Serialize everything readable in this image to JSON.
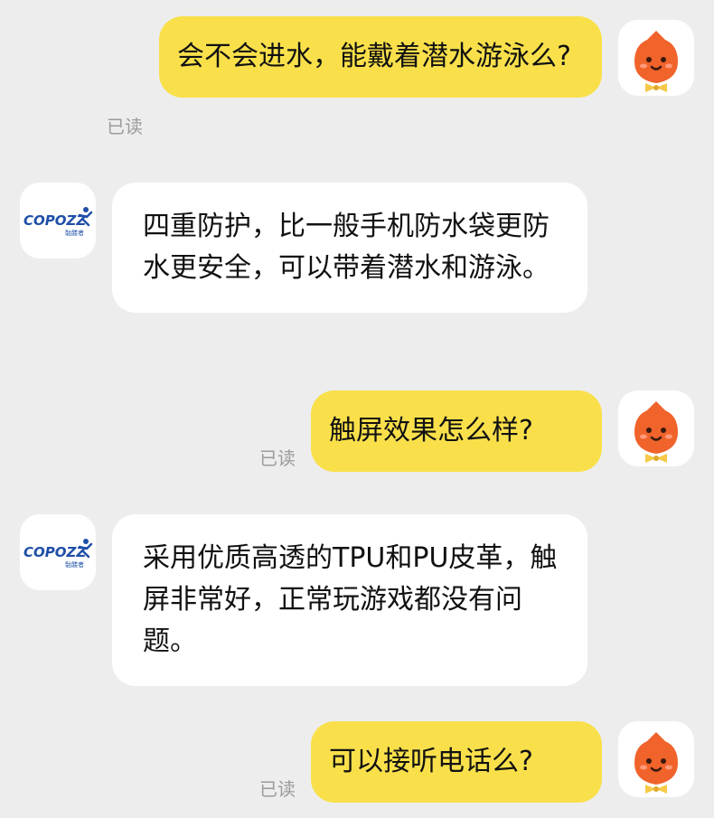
{
  "colors": {
    "background": "#ededed",
    "outgoing_bubble": "#f9e04b",
    "incoming_bubble": "#ffffff",
    "read_status": "#9b9b9b",
    "brand_blue": "#1f4fa8",
    "mascot_orange": "#f0632b",
    "bowtie_yellow": "#f7c948"
  },
  "contact": {
    "brand_name": "COPOZZ",
    "brand_subtext": "骷髅者",
    "avatar_icon": "copozz-logo-icon"
  },
  "self": {
    "avatar_icon": "orange-mascot-icon"
  },
  "messages": [
    {
      "direction": "outgoing",
      "text": "会不会进水，能戴着潜水游泳么?",
      "status": "已读"
    },
    {
      "direction": "incoming",
      "text": "四重防护，比一般手机防水袋更防水更安全，可以带着潜水和游泳。"
    },
    {
      "direction": "outgoing",
      "text": "触屏效果怎么样?",
      "status": "已读"
    },
    {
      "direction": "incoming",
      "text": "采用优质高透的TPU和PU皮革，触屏非常好，正常玩游戏都没有问题。"
    },
    {
      "direction": "outgoing",
      "text": "可以接听电话么?",
      "status": "已读"
    }
  ]
}
